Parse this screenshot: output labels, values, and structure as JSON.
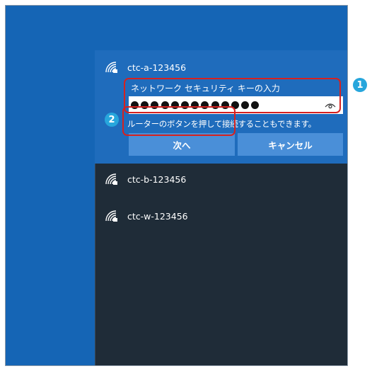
{
  "networks": [
    {
      "ssid": "ctc-a-123456",
      "icon": "wifi-signal-icon",
      "expanded": true
    },
    {
      "ssid": "ctc-b-123456",
      "icon": "wifi-signal-icon",
      "expanded": false
    },
    {
      "ssid": "ctc-w-123456",
      "icon": "wifi-signal-icon",
      "expanded": false
    }
  ],
  "connect_form": {
    "key_label": "ネットワーク セキュリティ キーの入力",
    "password_value": "●●●●●●●●●●●●●",
    "hint": "ルーターのボタンを押して接続することもできます。",
    "next_label": "次へ",
    "cancel_label": "キャンセル"
  },
  "annotations": {
    "badge_1": "1",
    "badge_2": "2",
    "highlight_color": "#d6211f",
    "badge_color": "#27a6dc"
  },
  "colors": {
    "desktop": "#1565b5",
    "flyout": "#1f2c38",
    "selected_network": "#1f6cbc",
    "button": "#4a8fd8"
  }
}
